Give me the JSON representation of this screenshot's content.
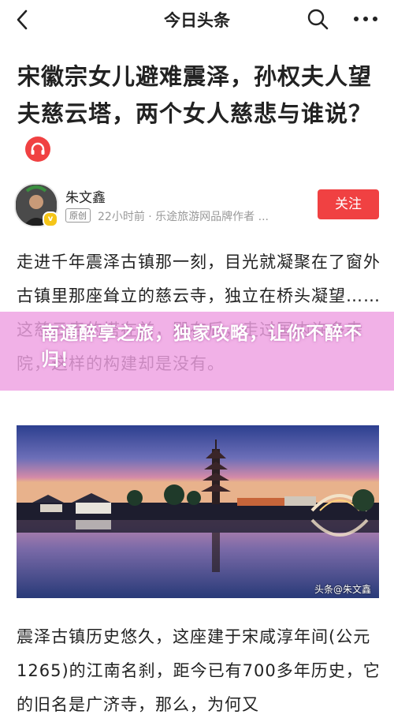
{
  "topbar": {
    "app_title": "今日头条"
  },
  "article": {
    "title": "宋徽宗女儿避难震泽，孙权夫人望夫慈云塔，两个女人慈悲与谁说？",
    "author": {
      "name": "朱文鑫",
      "origin_badge": "原创",
      "meta": "22小时前 · 乐途旅游网品牌作者 ..."
    },
    "follow_label": "关注",
    "paragraph1": "走进千年震泽古镇那一刻，目光就凝聚在了窗外古镇里那座耸立的慈云寺，独立在桥头凝望……这慈云寺的塔在前，殿在后，走过国内许多寺院，这样的构建却是没有。",
    "paragraph2": "震泽古镇历史悠久，这座建于宋咸淳年间(公元1265)的江南名刹，距今已有700多年历史，它的旧名是广济寺，那么，为何又",
    "photo_credit": "头条@朱文鑫"
  },
  "overlay": {
    "banner_text": "南通醉享之旅，独家攻略，让你不醉不归！"
  },
  "colors": {
    "accent_red": "#f04142",
    "banner_pink": "#eea0e2"
  }
}
